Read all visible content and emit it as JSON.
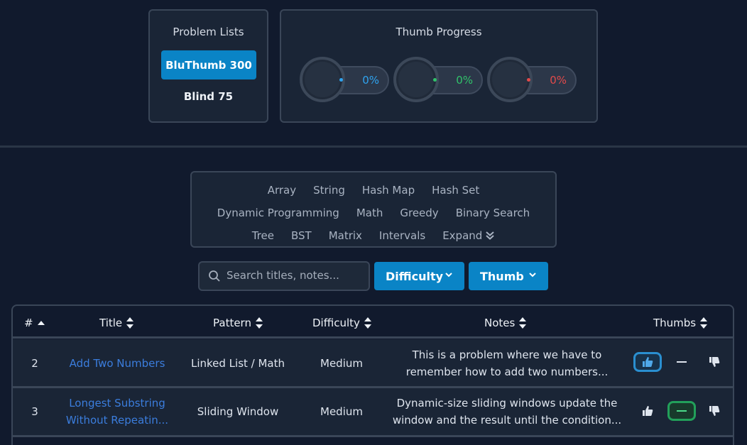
{
  "lists": {
    "title": "Problem Lists",
    "items": [
      "BluThumb 300",
      "Blind 75"
    ]
  },
  "progress": {
    "title": "Thumb Progress",
    "meters": [
      {
        "value": "0%",
        "color": "#2fa3ef",
        "icon": "thumb-up-icon"
      },
      {
        "value": "0%",
        "color": "#31c26a",
        "icon": "dash-icon"
      },
      {
        "value": "0%",
        "color": "#e24a4a",
        "icon": "thumb-down-icon"
      }
    ]
  },
  "tags": {
    "row1": [
      "Array",
      "String",
      "Hash Map",
      "Hash Set"
    ],
    "row2": [
      "Dynamic Programming",
      "Math",
      "Greedy",
      "Binary Search"
    ],
    "row3": [
      "Tree",
      "BST",
      "Matrix",
      "Intervals"
    ],
    "expand_label": "Expand"
  },
  "filters": {
    "search_placeholder": "Search titles, notes...",
    "difficulty_label": "Difficulty",
    "thumb_label": "Thumb"
  },
  "table": {
    "headers": [
      "#",
      "Title",
      "Pattern",
      "Difficulty",
      "Notes",
      "Thumbs"
    ],
    "rows": [
      {
        "num": "2",
        "title": "Add Two Numbers",
        "pattern": "Linked List / Math",
        "difficulty": "Medium",
        "notes_line1": "This is a problem where we have to",
        "notes_line2": "remember how to add two numbers...",
        "selected": "up"
      },
      {
        "num": "3",
        "title_line1": "Longest Substring",
        "title_line2": "Without Repeatin...",
        "pattern": "Sliding Window",
        "difficulty": "Medium",
        "notes_line1": "Dynamic-size sliding windows update the",
        "notes_line2": "window and the result until the condition...",
        "selected": "neutral"
      }
    ]
  },
  "colors": {
    "accent": "#0a84c6",
    "up_border": "#2a8fd0",
    "neutral_border": "#22a05a",
    "link": "#3b7ddd"
  }
}
